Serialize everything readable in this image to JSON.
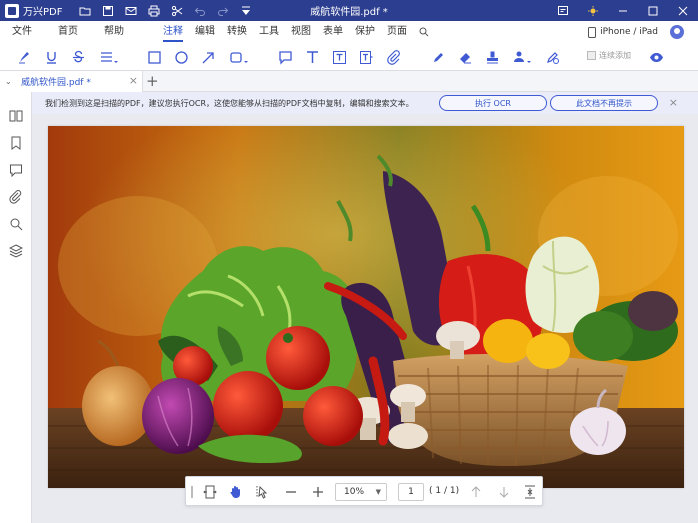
{
  "app": {
    "name": "万兴PDF",
    "doc_title": "威航软件园.pdf *"
  },
  "menu": {
    "items": [
      "文件",
      "首页",
      "帮助",
      "注释",
      "编辑",
      "转换",
      "工具",
      "视图",
      "表单",
      "保护",
      "页面"
    ],
    "active": "注释",
    "device_label": "iPhone / iPad"
  },
  "toolbar": {
    "auto_add_label": "连续添加"
  },
  "tab": {
    "name": "威航软件园.pdf *"
  },
  "notice": {
    "message": "我们检测到这是扫描的PDF，建议您执行OCR，这使您能够从扫描的PDF文档中复制，编辑和搜索文本。",
    "ocr_button": "执行 OCR",
    "dismiss_button": "此文档不再提示"
  },
  "navbar": {
    "zoom": "10%",
    "page_number": "1",
    "page_total": "( 1 / 1)"
  },
  "colors": {
    "accent": "#2f54c8",
    "title_bar": "#2c3e8f",
    "notice_bg": "#eaecfa"
  }
}
